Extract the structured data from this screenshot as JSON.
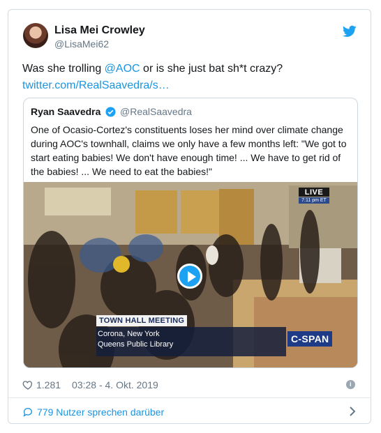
{
  "author": {
    "name": "Lisa Mei Crowley",
    "handle": "@LisaMei62"
  },
  "tweet": {
    "text_before": "Was she trolling ",
    "mention": "@AOC",
    "text_after": " or is she just bat sh*t crazy?",
    "link": "twitter.com/RealSaavedra/s…"
  },
  "quoted": {
    "name": "Ryan Saavedra",
    "handle": "@RealSaavedra",
    "text": "One of Ocasio-Cortez's constituents loses her mind over climate change during AOC's townhall, claims we only have a few months left: \"We got to start eating babies! We don't have enough time! ...  We have to get rid of the babies! ... We need to eat the babies!\""
  },
  "video": {
    "live_label": "LIVE",
    "live_time": "7:11 pm ET",
    "chyron_title": "TOWN HALL MEETING",
    "chyron_line1": "Corona, New York",
    "chyron_line2": "Queens Public Library",
    "network": "C-SPAN"
  },
  "meta": {
    "likes": "1.281",
    "timestamp": "03:28 - 4. Okt. 2019"
  },
  "footer": {
    "talking": "779 Nutzer sprechen darüber"
  },
  "colors": {
    "accent": "#1da1f2",
    "link": "#1b95e0",
    "secondary": "#657786"
  }
}
